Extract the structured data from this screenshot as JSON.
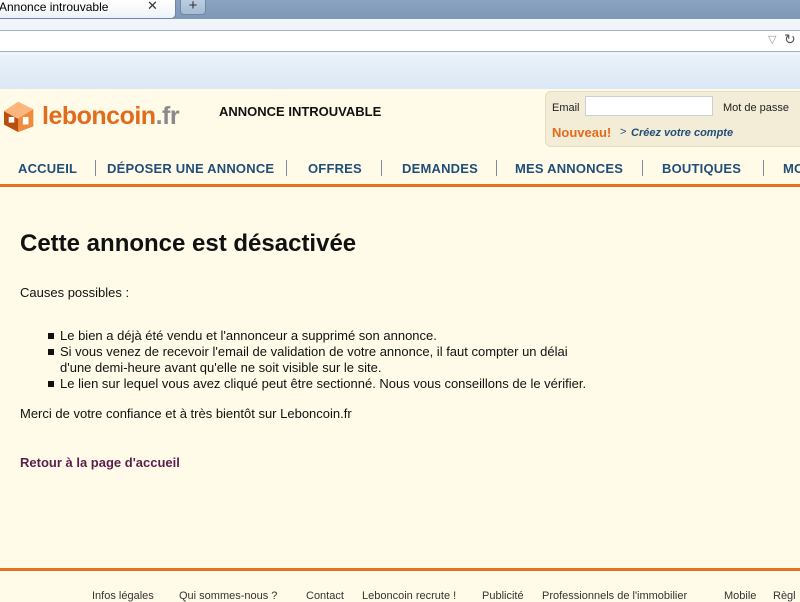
{
  "browser": {
    "tab_title": "Annonce introuvable",
    "tab_close_glyph": "✕",
    "new_tab_glyph": "+",
    "url_dropdown_glyph": "▽",
    "url_reload_glyph": "↻"
  },
  "header": {
    "logo_name": "leboncoin",
    "logo_tld": ".fr",
    "page_heading": "ANNONCE INTROUVABLE",
    "login": {
      "email_label": "Email",
      "email_value": "",
      "password_label": "Mot de passe",
      "new_label": "Nouveau!",
      "arrow": ">",
      "create_account": "Créez votre compte"
    }
  },
  "nav": {
    "items": [
      "ACCUEIL",
      "DÉPOSER UNE ANNONCE",
      "OFFRES",
      "DEMANDES",
      "MES ANNONCES",
      "BOUTIQUES",
      "MO"
    ]
  },
  "main": {
    "title": "Cette annonce est désactivée",
    "causes_label": "Causes possibles :",
    "causes": [
      "Le bien a déjà été vendu et l'annonceur a supprimé son annonce.",
      "Si vous venez de recevoir l'email de validation de votre annonce, il faut compter un délai d'une demi-heure avant qu'elle ne soit visible sur le site.",
      "Le lien sur lequel vous avez cliqué peut être sectionné. Nous vous conseillons de le vérifier."
    ],
    "thanks": "Merci de votre confiance et à très bientôt sur Leboncoin.fr",
    "back_link": "Retour à la page d'accueil"
  },
  "footer": {
    "links": [
      "Infos légales",
      "Qui sommes-nous ?",
      "Contact",
      "Leboncoin recrute !",
      "Publicité",
      "Professionnels de l'immobilier",
      "Mobile",
      "Règl"
    ]
  },
  "colors": {
    "brand_orange": "#e36b1c",
    "nav_blue": "#1f4e79",
    "page_background": "#fffbe8",
    "link_purple": "#5a1e4d"
  },
  "icons": {
    "logo": "house-box-icon",
    "tab_close": "close-icon",
    "new_tab": "plus-icon",
    "dropdown": "triangle-down-icon",
    "reload": "reload-icon"
  }
}
